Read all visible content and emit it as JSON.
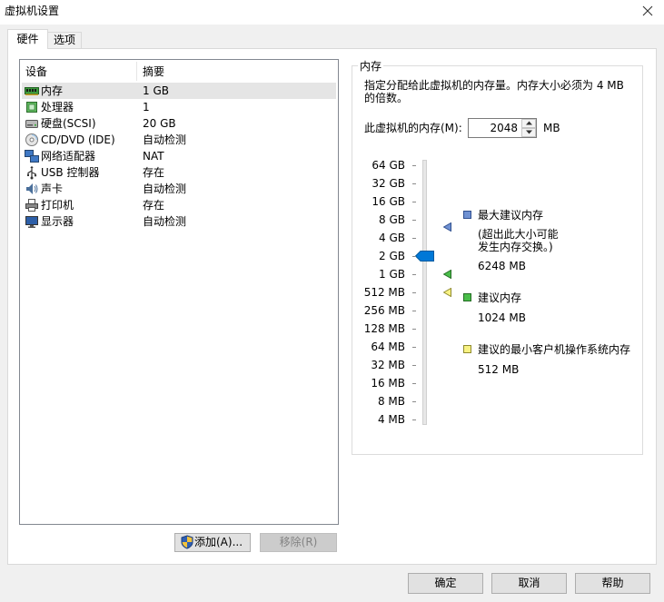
{
  "window": {
    "title": "虚拟机设置",
    "close_icon": "close-icon"
  },
  "tabs": [
    {
      "label": "硬件",
      "selected": true
    },
    {
      "label": "选项",
      "selected": false
    }
  ],
  "devices": {
    "columns": {
      "device": "设备",
      "summary": "摘要"
    },
    "rows": [
      {
        "icon": "memory-icon",
        "name": "内存",
        "summary": "1 GB",
        "selected": true
      },
      {
        "icon": "processor-icon",
        "name": "处理器",
        "summary": "1",
        "selected": false
      },
      {
        "icon": "hard-disk-icon",
        "name": "硬盘(SCSI)",
        "summary": "20 GB",
        "selected": false
      },
      {
        "icon": "cd-dvd-icon",
        "name": "CD/DVD (IDE)",
        "summary": "自动检测",
        "selected": false
      },
      {
        "icon": "network-adapter-icon",
        "name": "网络适配器",
        "summary": "NAT",
        "selected": false
      },
      {
        "icon": "usb-icon",
        "name": "USB 控制器",
        "summary": "存在",
        "selected": false
      },
      {
        "icon": "sound-card-icon",
        "name": "声卡",
        "summary": "自动检测",
        "selected": false
      },
      {
        "icon": "printer-icon",
        "name": "打印机",
        "summary": "存在",
        "selected": false
      },
      {
        "icon": "display-icon",
        "name": "显示器",
        "summary": "自动检测",
        "selected": false
      }
    ],
    "add_button": {
      "label": "添加(A)...",
      "icon": "uac-shield-icon"
    },
    "remove_button": {
      "label": "移除(R)",
      "enabled": false
    }
  },
  "memory": {
    "title": "内存",
    "description_lines": [
      "指定分配给此虚拟机的内存量。内存大小必须为 4 MB",
      "的倍数。"
    ],
    "field_label": "此虚拟机的内存(M):",
    "value": "2048",
    "unit": "MB",
    "slider": {
      "scale_labels": [
        "64 GB",
        "32 GB",
        "16 GB",
        "8 GB",
        "4 GB",
        "2 GB",
        "1 GB",
        "512 MB",
        "256 MB",
        "128 MB",
        "64 MB",
        "32 MB",
        "16 MB",
        "8 MB",
        "4 MB"
      ],
      "value_mb": 2048,
      "thumb_color": "#0078d7"
    },
    "legend": [
      {
        "label": "最大建议内存",
        "note_lines": [
          "(超出此大小可能",
          "发生内存交换。)"
        ],
        "value_text": "6248 MB",
        "value_mb": 6248,
        "color": "#6f91d2",
        "border_color": "#2f4f8f"
      },
      {
        "label": "建议内存",
        "value_text": "1024 MB",
        "value_mb": 1024,
        "color": "#49bd49",
        "border_color": "#246b24"
      },
      {
        "label": "建议的最小客户机操作系统内存",
        "value_text": "512 MB",
        "value_mb": 512,
        "color": "#f8f283",
        "border_color": "#8f8a2f"
      }
    ]
  },
  "footer": {
    "ok": "确定",
    "cancel": "取消",
    "help": "帮助"
  }
}
